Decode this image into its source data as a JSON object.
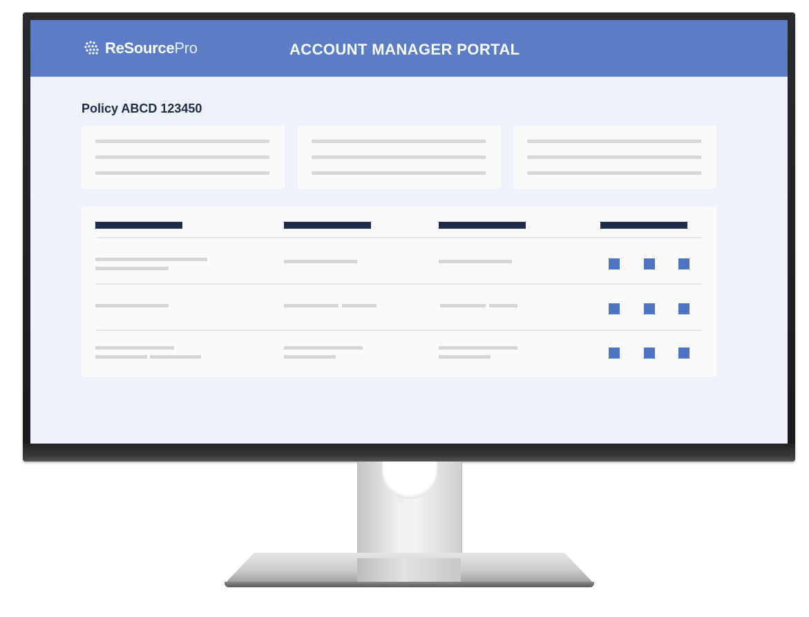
{
  "header": {
    "brand_bold": "ReSource",
    "brand_light": "Pro",
    "title": "ACCOUNT MANAGER PORTAL"
  },
  "policy": {
    "title": "Policy ABCD 123450"
  },
  "colors": {
    "header_blue": "#5b7cc6",
    "screen_background": "#edf2fc",
    "column_header_navy": "#1c2b4c",
    "action_square_blue": "#4d73c3"
  },
  "icons": {
    "logo": "globe-icon",
    "row_actions": "square-icon"
  },
  "summary_cards": [
    {
      "lines": 3
    },
    {
      "lines": 3
    },
    {
      "lines": 3
    }
  ],
  "table": {
    "column_count": 4,
    "row_count": 3,
    "actions_per_row": 3
  }
}
